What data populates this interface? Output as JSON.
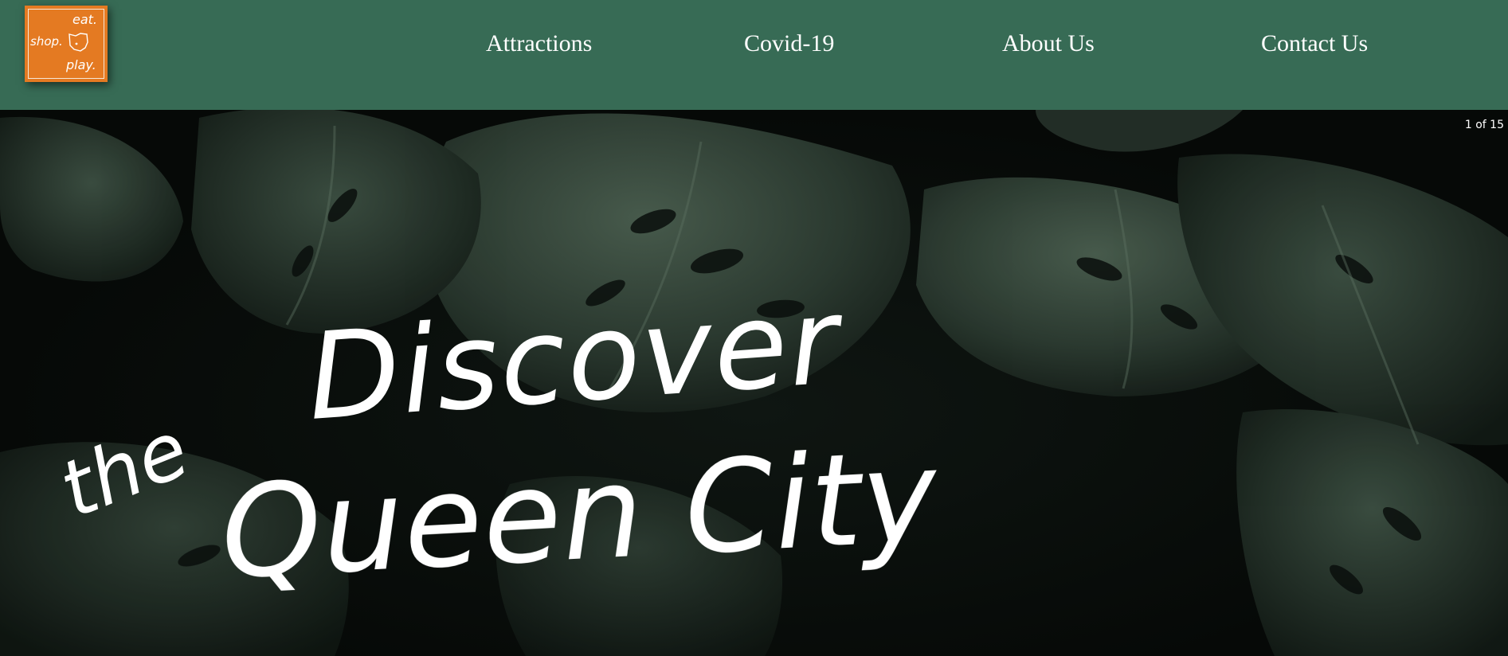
{
  "logo": {
    "eat": "eat.",
    "shop": "shop.",
    "play": "play.",
    "icon": "ohio-map-icon",
    "color": "#e47a22"
  },
  "header": {
    "background": "#376b55",
    "nav": [
      "Attractions",
      "Covid-19",
      "About Us",
      "Contact Us"
    ]
  },
  "hero": {
    "slide_counter": "1 of 15",
    "headline": {
      "discover": "Discover",
      "the": "the",
      "queen_city": "Queen City"
    }
  }
}
